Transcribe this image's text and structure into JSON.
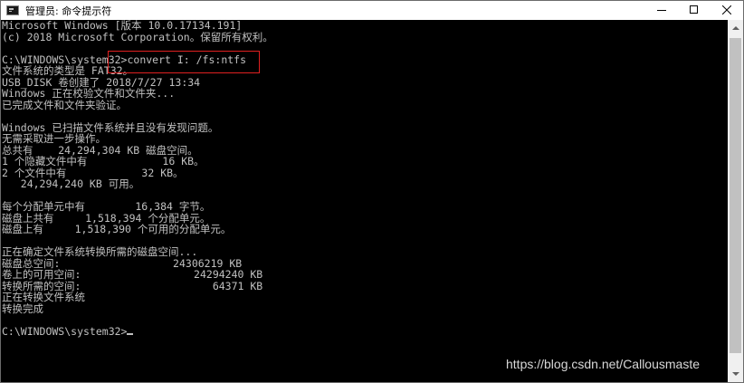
{
  "window": {
    "title": "管理员: 命令提示符"
  },
  "console": {
    "lines": [
      "Microsoft Windows [版本 10.0.17134.191]",
      "(c) 2018 Microsoft Corporation。保留所有权利。",
      "",
      "C:\\WINDOWS\\system32>convert I: /fs:ntfs",
      "文件系统的类型是 FAT32。",
      "USB_DISK 卷创建了 2018/7/27 13:34",
      "Windows 正在校验文件和文件夹...",
      "已完成文件和文件夹验证。",
      "",
      "Windows 已扫描文件系统并且没有发现问题。",
      "无需采取进一步操作。",
      "总共有    24,294,304 KB 磁盘空间。",
      "1 个隐藏文件中有            16 KB。",
      "2 个文件中有            32 KB。",
      "   24,294,240 KB 可用。",
      "",
      "每个分配单元中有        16,384 字节。",
      "磁盘上共有     1,518,394 个分配单元。",
      "磁盘上有     1,518,390 个可用的分配单元。",
      "",
      "正在确定文件系统转换所需的磁盘空间...",
      "磁盘总空间:                  24306219 KB",
      "卷上的可用空间:                  24294240 KB",
      "转换所需的空间:                     64371 KB",
      "正在转换文件系统",
      "转换完成",
      ""
    ],
    "prompt": "C:\\WINDOWS\\system32>"
  },
  "watermark": {
    "text": "https://blog.csdn.net/Callousmaste"
  },
  "colors": {
    "console_bg": "#000000",
    "console_text": "#c0c0c0",
    "highlight_border": "#e02020",
    "titlebar_bg": "#ffffff"
  },
  "icons": {
    "app": "console-icon",
    "minimize": "minimize-icon",
    "maximize": "maximize-icon",
    "close": "close-icon"
  }
}
